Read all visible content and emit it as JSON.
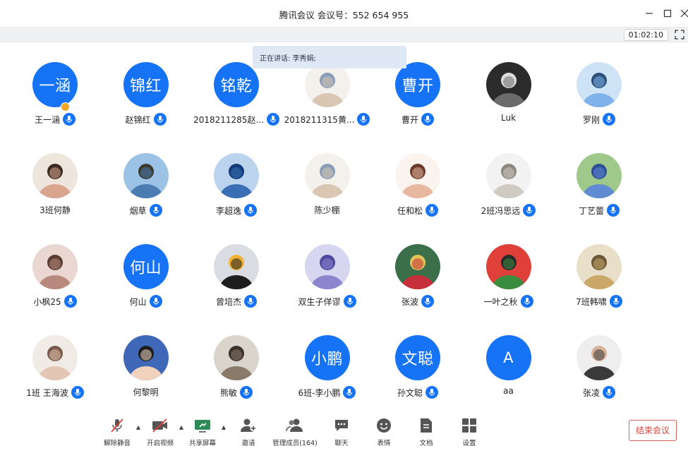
{
  "window": {
    "title": "腾讯会议 会议号：552 654 955"
  },
  "meeting": {
    "timer": "01:02:10",
    "speaking": "正在讲话: 李秀娟;"
  },
  "participants": [
    {
      "name": "王一涵",
      "avatar_text": "一涵",
      "mic": true,
      "host": true
    },
    {
      "name": "赵锦红",
      "avatar_text": "锦红",
      "mic": true
    },
    {
      "name": "2018211285赵...",
      "avatar_text": "铭乾",
      "mic": true
    },
    {
      "name": "2018211315黄...",
      "avatar_image": "cartoon-boy-photo",
      "mic": true
    },
    {
      "name": "曹开",
      "avatar_text": "曹开",
      "mic": true
    },
    {
      "name": "Luk",
      "avatar_image": "dark-silhouette-photo",
      "mic": false
    },
    {
      "name": "罗刚",
      "avatar_image": "boy-sky-photo",
      "mic": true
    },
    {
      "name": "3班何静",
      "avatar_image": "child-photo",
      "mic": false
    },
    {
      "name": "烟草",
      "avatar_image": "bicycle-lake-photo",
      "mic": true
    },
    {
      "name": "李超逸",
      "avatar_image": "soccer-player-photo",
      "mic": true
    },
    {
      "name": "陈少棚",
      "avatar_image": "cartoon-boy-photo",
      "mic": false
    },
    {
      "name": "任和松",
      "avatar_image": "cat-girl-cartoon",
      "mic": true
    },
    {
      "name": "2班冯思远",
      "avatar_image": "cat-meme-photo",
      "mic": true
    },
    {
      "name": "丁艺蕾",
      "avatar_image": "stitch-cartoon",
      "mic": true
    },
    {
      "name": "小枫25",
      "avatar_image": "person-street-photo",
      "mic": true
    },
    {
      "name": "何山",
      "avatar_text": "何山",
      "mic": true
    },
    {
      "name": "曾培杰",
      "avatar_image": "penguin-photo",
      "mic": true
    },
    {
      "name": "双生子佯谬",
      "avatar_image": "anime-purple-photo",
      "mic": true
    },
    {
      "name": "张波",
      "avatar_image": "christmas-balls-photo",
      "mic": true
    },
    {
      "name": "一叶之秋",
      "avatar_image": "red-cartoon",
      "mic": true
    },
    {
      "name": "7班韩啸",
      "avatar_image": "dog-photo",
      "mic": true
    },
    {
      "name": "1班 王海波",
      "avatar_image": "girl-portrait-photo",
      "mic": true
    },
    {
      "name": "何黎明",
      "avatar_image": "cartoon-boy-glasses",
      "mic": false
    },
    {
      "name": "熊敏",
      "avatar_image": "cat-photo",
      "mic": true
    },
    {
      "name": "6班-李小鹏",
      "avatar_text": "小鹏",
      "mic": true
    },
    {
      "name": "孙文聪",
      "avatar_text": "文聪",
      "mic": true
    },
    {
      "name": "aa",
      "avatar_text": "A",
      "mic": false
    },
    {
      "name": "张凌",
      "avatar_image": "man-suit-photo",
      "mic": true
    }
  ],
  "toolbar": {
    "unmute": "解除静音",
    "video": "开启视频",
    "share": "共享屏幕",
    "invite": "邀请",
    "members": "管理成员(164)",
    "chat": "聊天",
    "emoji": "表情",
    "docs": "文档",
    "settings": "设置",
    "end": "结束会议"
  },
  "colors": {
    "accent": "#1673f5",
    "end": "#e0403a"
  }
}
